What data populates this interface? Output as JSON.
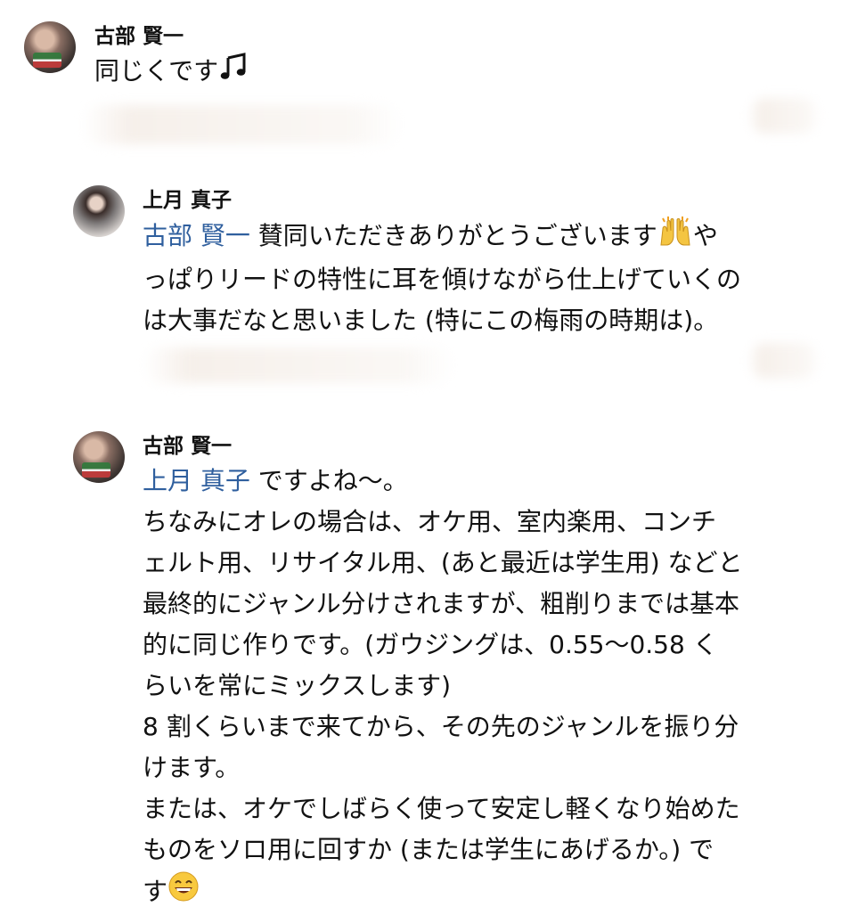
{
  "messages": [
    {
      "author": "古部 賢一",
      "lines": [
        "同じくです"
      ],
      "emoji": "music-notes-icon"
    },
    {
      "author": "上月 真子",
      "mention": "古部 賢一",
      "lines": [
        " 賛同いただきありがとうございます",
        "や",
        "っぱりリードの特性に耳を傾けながら仕上げていくの",
        "は大事だなと思いました (特にこの梅雨の時期は)。"
      ],
      "emoji": "raising-hands-icon"
    },
    {
      "author": "古部 賢一",
      "mention": "上月 真子",
      "lines": [
        " ですよね〜。",
        "ちなみにオレの場合は、オケ用、室内楽用、コンチ",
        "ェルト用、リサイタル用、(あと最近は学生用) などと",
        "最終的にジャンル分けされますが、粗削りまでは基本",
        "的に同じ作りです。(ガウジングは、0.55〜0.58 く",
        "らいを常にミックスします)",
        "8 割くらいまで来てから、その先のジャンルを振り分",
        "けます。",
        "または、オケでしばらく使って安定し軽くなり始めた",
        "ものをソロ用に回すか (または学生にあげるか。) で",
        "す"
      ],
      "emoji": "grinning-face-icon"
    }
  ]
}
